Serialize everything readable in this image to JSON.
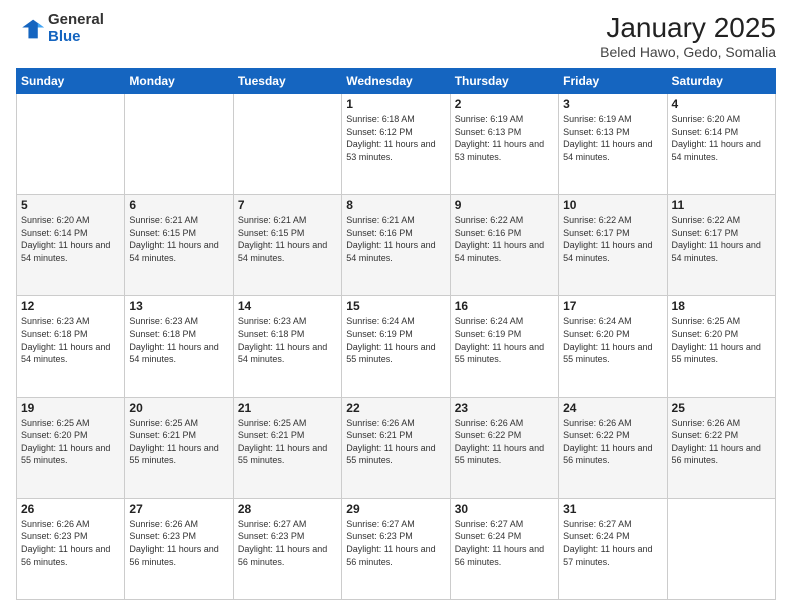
{
  "logo": {
    "general": "General",
    "blue": "Blue"
  },
  "title": {
    "month": "January 2025",
    "location": "Beled Hawo, Gedo, Somalia"
  },
  "weekdays": [
    "Sunday",
    "Monday",
    "Tuesday",
    "Wednesday",
    "Thursday",
    "Friday",
    "Saturday"
  ],
  "weeks": [
    [
      null,
      null,
      null,
      {
        "day": 1,
        "sunrise": "6:18 AM",
        "sunset": "6:12 PM",
        "daylight": "11 hours and 53 minutes."
      },
      {
        "day": 2,
        "sunrise": "6:19 AM",
        "sunset": "6:13 PM",
        "daylight": "11 hours and 53 minutes."
      },
      {
        "day": 3,
        "sunrise": "6:19 AM",
        "sunset": "6:13 PM",
        "daylight": "11 hours and 54 minutes."
      },
      {
        "day": 4,
        "sunrise": "6:20 AM",
        "sunset": "6:14 PM",
        "daylight": "11 hours and 54 minutes."
      }
    ],
    [
      {
        "day": 5,
        "sunrise": "6:20 AM",
        "sunset": "6:14 PM",
        "daylight": "11 hours and 54 minutes."
      },
      {
        "day": 6,
        "sunrise": "6:21 AM",
        "sunset": "6:15 PM",
        "daylight": "11 hours and 54 minutes."
      },
      {
        "day": 7,
        "sunrise": "6:21 AM",
        "sunset": "6:15 PM",
        "daylight": "11 hours and 54 minutes."
      },
      {
        "day": 8,
        "sunrise": "6:21 AM",
        "sunset": "6:16 PM",
        "daylight": "11 hours and 54 minutes."
      },
      {
        "day": 9,
        "sunrise": "6:22 AM",
        "sunset": "6:16 PM",
        "daylight": "11 hours and 54 minutes."
      },
      {
        "day": 10,
        "sunrise": "6:22 AM",
        "sunset": "6:17 PM",
        "daylight": "11 hours and 54 minutes."
      },
      {
        "day": 11,
        "sunrise": "6:22 AM",
        "sunset": "6:17 PM",
        "daylight": "11 hours and 54 minutes."
      }
    ],
    [
      {
        "day": 12,
        "sunrise": "6:23 AM",
        "sunset": "6:18 PM",
        "daylight": "11 hours and 54 minutes."
      },
      {
        "day": 13,
        "sunrise": "6:23 AM",
        "sunset": "6:18 PM",
        "daylight": "11 hours and 54 minutes."
      },
      {
        "day": 14,
        "sunrise": "6:23 AM",
        "sunset": "6:18 PM",
        "daylight": "11 hours and 54 minutes."
      },
      {
        "day": 15,
        "sunrise": "6:24 AM",
        "sunset": "6:19 PM",
        "daylight": "11 hours and 55 minutes."
      },
      {
        "day": 16,
        "sunrise": "6:24 AM",
        "sunset": "6:19 PM",
        "daylight": "11 hours and 55 minutes."
      },
      {
        "day": 17,
        "sunrise": "6:24 AM",
        "sunset": "6:20 PM",
        "daylight": "11 hours and 55 minutes."
      },
      {
        "day": 18,
        "sunrise": "6:25 AM",
        "sunset": "6:20 PM",
        "daylight": "11 hours and 55 minutes."
      }
    ],
    [
      {
        "day": 19,
        "sunrise": "6:25 AM",
        "sunset": "6:20 PM",
        "daylight": "11 hours and 55 minutes."
      },
      {
        "day": 20,
        "sunrise": "6:25 AM",
        "sunset": "6:21 PM",
        "daylight": "11 hours and 55 minutes."
      },
      {
        "day": 21,
        "sunrise": "6:25 AM",
        "sunset": "6:21 PM",
        "daylight": "11 hours and 55 minutes."
      },
      {
        "day": 22,
        "sunrise": "6:26 AM",
        "sunset": "6:21 PM",
        "daylight": "11 hours and 55 minutes."
      },
      {
        "day": 23,
        "sunrise": "6:26 AM",
        "sunset": "6:22 PM",
        "daylight": "11 hours and 55 minutes."
      },
      {
        "day": 24,
        "sunrise": "6:26 AM",
        "sunset": "6:22 PM",
        "daylight": "11 hours and 56 minutes."
      },
      {
        "day": 25,
        "sunrise": "6:26 AM",
        "sunset": "6:22 PM",
        "daylight": "11 hours and 56 minutes."
      }
    ],
    [
      {
        "day": 26,
        "sunrise": "6:26 AM",
        "sunset": "6:23 PM",
        "daylight": "11 hours and 56 minutes."
      },
      {
        "day": 27,
        "sunrise": "6:26 AM",
        "sunset": "6:23 PM",
        "daylight": "11 hours and 56 minutes."
      },
      {
        "day": 28,
        "sunrise": "6:27 AM",
        "sunset": "6:23 PM",
        "daylight": "11 hours and 56 minutes."
      },
      {
        "day": 29,
        "sunrise": "6:27 AM",
        "sunset": "6:23 PM",
        "daylight": "11 hours and 56 minutes."
      },
      {
        "day": 30,
        "sunrise": "6:27 AM",
        "sunset": "6:24 PM",
        "daylight": "11 hours and 56 minutes."
      },
      {
        "day": 31,
        "sunrise": "6:27 AM",
        "sunset": "6:24 PM",
        "daylight": "11 hours and 57 minutes."
      },
      null
    ]
  ]
}
